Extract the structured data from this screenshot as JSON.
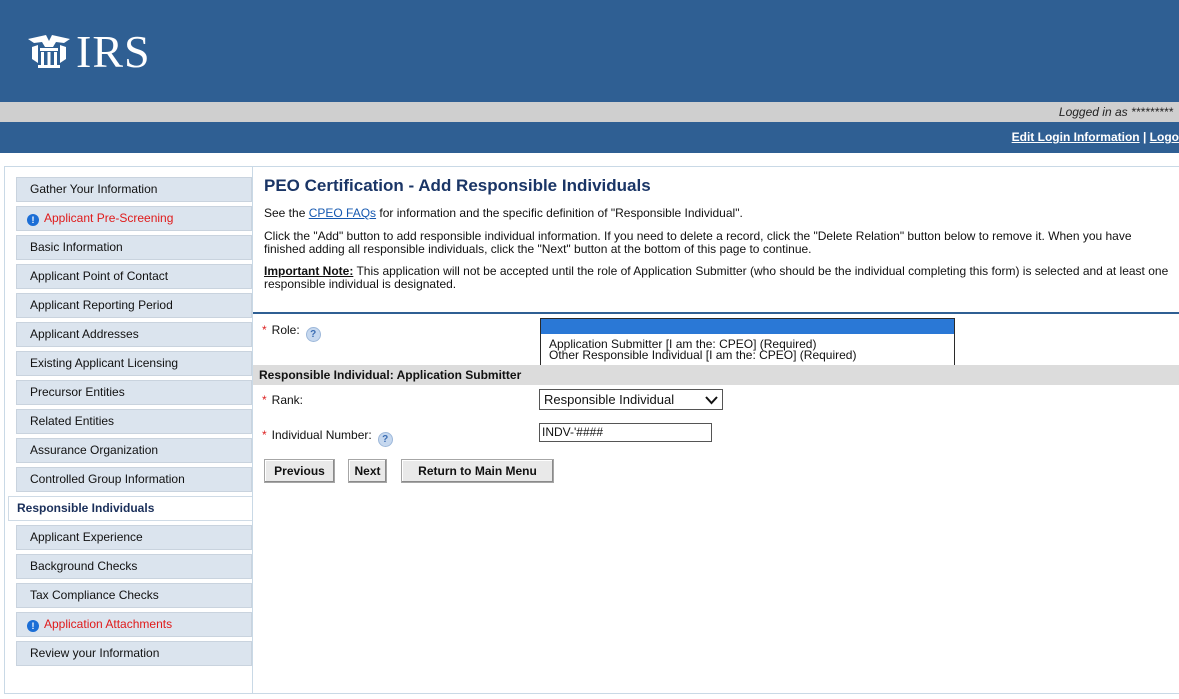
{
  "header": {
    "logo_text": "IRS",
    "logged_in_text": "Logged in as *********",
    "edit_login_label": "Edit Login Information",
    "separator": "|",
    "logout_label": "Logo"
  },
  "sidebar": {
    "items": [
      {
        "label": "Gather Your Information",
        "alert": false,
        "active": false
      },
      {
        "label": "Applicant Pre-Screening",
        "alert": true,
        "active": false
      },
      {
        "label": "Basic Information",
        "alert": false,
        "active": false
      },
      {
        "label": "Applicant Point of Contact",
        "alert": false,
        "active": false
      },
      {
        "label": "Applicant Reporting Period",
        "alert": false,
        "active": false
      },
      {
        "label": "Applicant Addresses",
        "alert": false,
        "active": false
      },
      {
        "label": "Existing Applicant Licensing",
        "alert": false,
        "active": false
      },
      {
        "label": "Precursor Entities",
        "alert": false,
        "active": false
      },
      {
        "label": "Related Entities",
        "alert": false,
        "active": false
      },
      {
        "label": "Assurance Organization",
        "alert": false,
        "active": false
      },
      {
        "label": "Controlled Group Information",
        "alert": false,
        "active": false
      },
      {
        "label": "Responsible Individuals",
        "alert": false,
        "active": true
      },
      {
        "label": "Applicant Experience",
        "alert": false,
        "active": false
      },
      {
        "label": "Background Checks",
        "alert": false,
        "active": false
      },
      {
        "label": "Tax Compliance Checks",
        "alert": false,
        "active": false
      },
      {
        "label": "Application Attachments",
        "alert": true,
        "active": false
      },
      {
        "label": "Review your Information",
        "alert": false,
        "active": false
      }
    ]
  },
  "main": {
    "title": "PEO Certification - Add Responsible Individuals",
    "faq_prefix": "See the ",
    "faq_link": "CPEO FAQs",
    "faq_suffix": " for information and the specific definition of \"Responsible Individual\".",
    "add_instructions": "Click the \"Add\" button to add responsible individual information. If you need to delete a record, click the \"Delete Relation\" button below to remove it. When you have finished adding all responsible individuals, click the \"Next\" button at the bottom of this page to continue.",
    "important_label": "Important Note:",
    "important_text": " This application will not be accepted until the role of Application Submitter (who should be the individual completing this form) is selected and at least one responsible individual is designated."
  },
  "form": {
    "role_label": "Role:",
    "role_options": [
      "Application Submitter [I am the: CPEO] (Required)",
      "Other Responsible Individual [I am the: CPEO] (Required)"
    ],
    "section_title": "Responsible Individual: Application Submitter",
    "rank_label": "Rank:",
    "rank_value": "Responsible Individual",
    "individual_number_label": "Individual Number:",
    "individual_number_value": "INDV-'####"
  },
  "buttons": {
    "previous": "Previous",
    "next": "Next",
    "return_main": "Return to Main Menu"
  },
  "colors": {
    "header_blue": "#2f5f93",
    "alert_red": "#e01a1a",
    "link_blue": "#1558b0",
    "selected_option": "#2a78d6"
  },
  "icons": [
    "irs-eagle-logo-icon",
    "info-alert-icon",
    "help-icon",
    "chevron-down-icon"
  ]
}
